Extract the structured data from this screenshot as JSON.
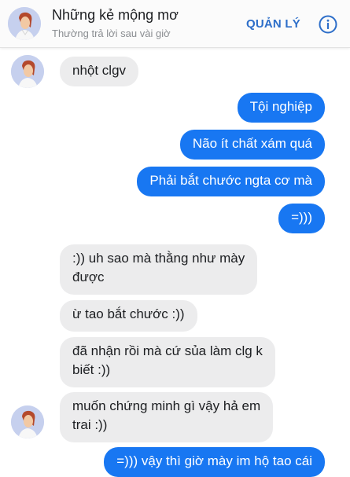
{
  "header": {
    "title": "Những kẻ mộng mơ",
    "subtitle": "Thường trả lời sau vài giờ",
    "manage_label": "QUẢN LÝ",
    "avatar_icon": "group-avatar-icon",
    "info_icon": "info-icon"
  },
  "colors": {
    "accent": "#2d6ec9",
    "outgoing_bubble": "#1877f2",
    "incoming_bubble": "#ececed"
  },
  "messages": [
    {
      "dir": "in",
      "text": "nhột clgv"
    },
    {
      "dir": "out",
      "text": "Tội nghiệp"
    },
    {
      "dir": "out",
      "text": "Não ít chất xám quá"
    },
    {
      "dir": "out",
      "text": "Phải bắt chước ngta cơ mà"
    },
    {
      "dir": "out",
      "text": "=)))"
    },
    {
      "dir": "in",
      "line1": ":)) uh sao mà thằng như mày",
      "line2": "được"
    },
    {
      "dir": "in",
      "text": "ừ tao bắt chước :))"
    },
    {
      "dir": "in",
      "line1": "đã nhận rồi mà cứ sủa làm clg k",
      "line2": "biết :))"
    },
    {
      "dir": "in",
      "line1": "muốn chứng minh gì vậy hả em",
      "line2": "trai :))"
    },
    {
      "dir": "out",
      "text": "=))) vậy thì giờ mày im hộ tao cái"
    }
  ]
}
